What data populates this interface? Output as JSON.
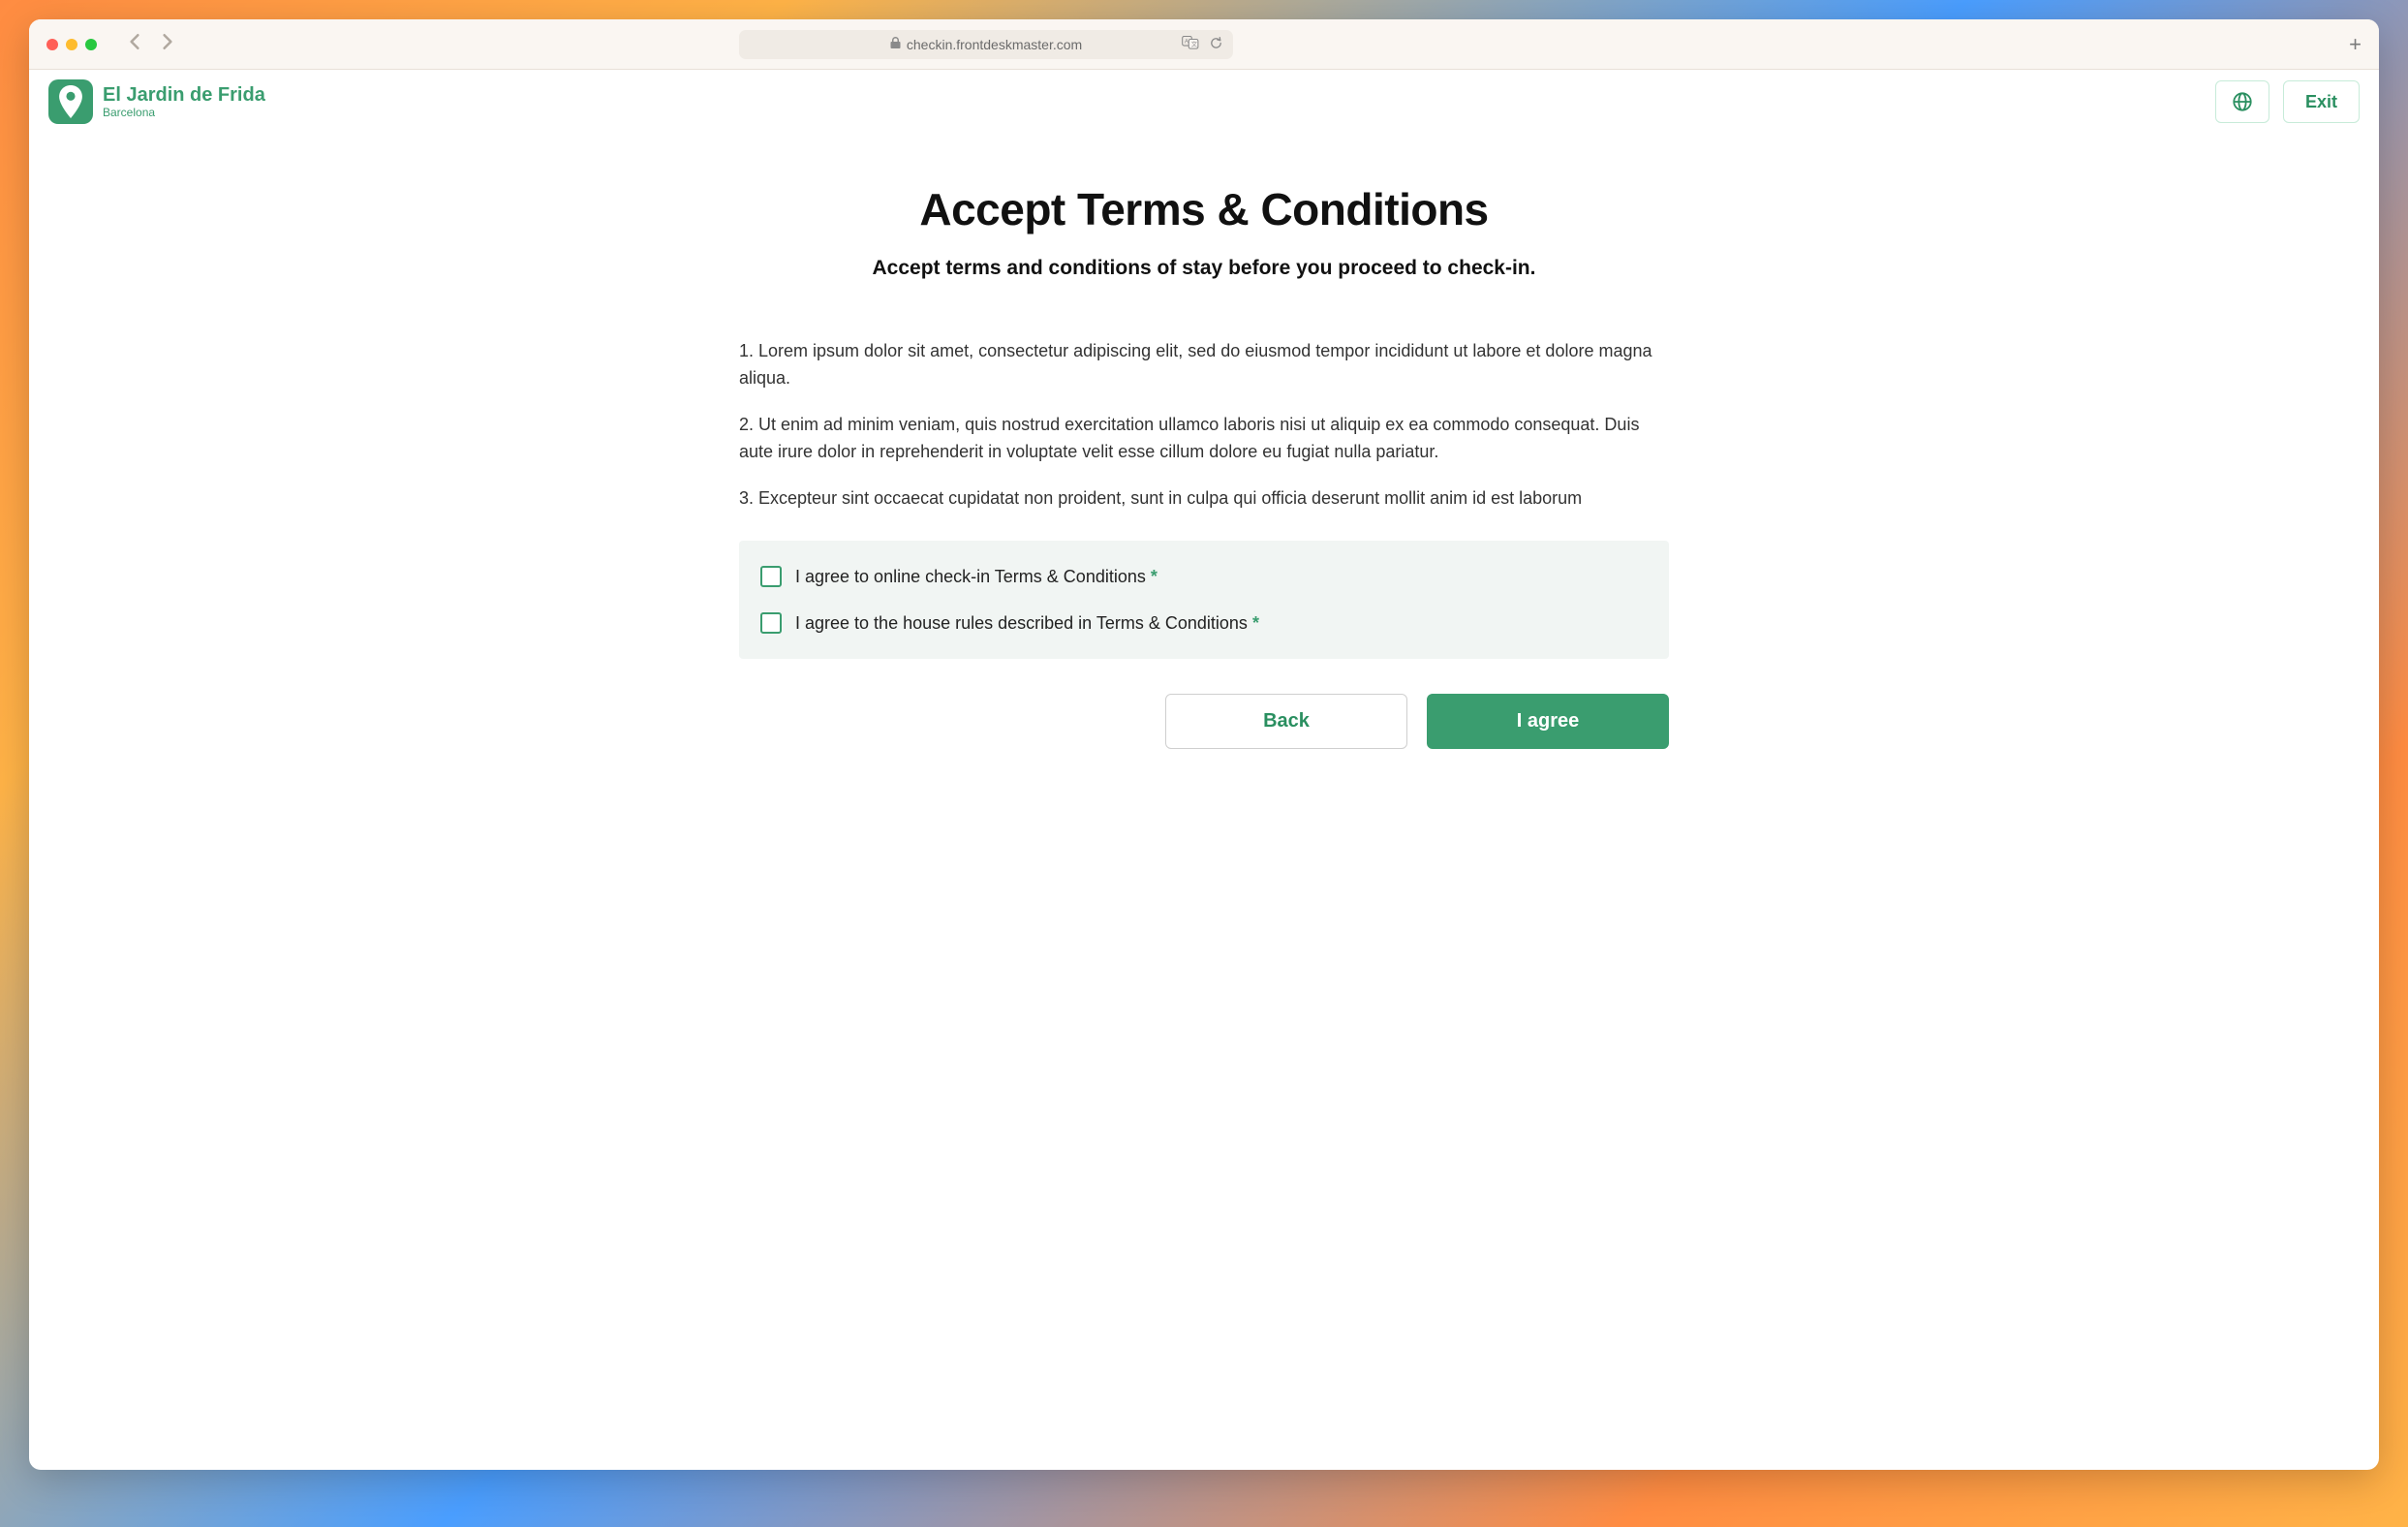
{
  "browser": {
    "url": "checkin.frontdeskmaster.com"
  },
  "header": {
    "hotel_name": "El Jardin de Frida",
    "hotel_location": "Barcelona",
    "exit_label": "Exit"
  },
  "page": {
    "title": "Accept Terms & Conditions",
    "subtitle": "Accept terms and conditions of stay before you proceed to check-in.",
    "paragraphs": [
      "1. Lorem ipsum dolor sit amet, consectetur adipiscing elit, sed do eiusmod tempor incididunt ut labore et dolore magna aliqua.",
      "2. Ut enim ad minim veniam, quis nostrud exercitation ullamco laboris nisi ut aliquip ex ea commodo consequat. Duis aute irure dolor in reprehenderit in voluptate velit esse cillum dolore eu fugiat nulla pariatur.",
      "3. Excepteur sint occaecat cupidatat non proident, sunt in culpa qui officia deserunt mollit anim id est laborum"
    ],
    "consents": [
      {
        "label": "I agree to online check-in Terms & Conditions",
        "required": true
      },
      {
        "label": "I agree to the house rules described in Terms & Conditions",
        "required": true
      }
    ],
    "back_label": "Back",
    "agree_label": "I agree"
  },
  "required_marker": " *"
}
